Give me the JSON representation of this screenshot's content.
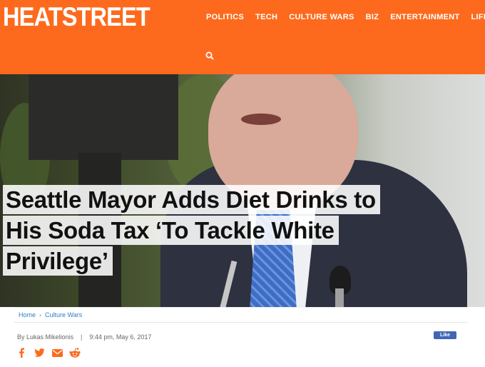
{
  "site": {
    "logo": "HEATSTREET",
    "nav": [
      "POLITICS",
      "TECH",
      "CULTURE WARS",
      "BIZ",
      "ENTERTAINMENT",
      "LIFE"
    ],
    "search_icon": "search-icon"
  },
  "article": {
    "headline_lines": [
      "Seattle Mayor Adds Diet Drinks to",
      "His Soda Tax ‘To Tackle White",
      "Privilege’"
    ],
    "breadcrumb": [
      "Home",
      "Culture Wars"
    ],
    "byline": {
      "author": "By Lukas Mikelionis",
      "timestamp": "9:44 pm, May 6, 2017"
    },
    "like_label": "Like",
    "share_icons": [
      "facebook-icon",
      "twitter-icon",
      "email-icon",
      "reddit-icon"
    ]
  },
  "colors": {
    "header_bg": "#fd6a1d",
    "share_icon": "#fd6a1d",
    "link": "#2f7fc1",
    "facebook_like": "#4267b2"
  }
}
